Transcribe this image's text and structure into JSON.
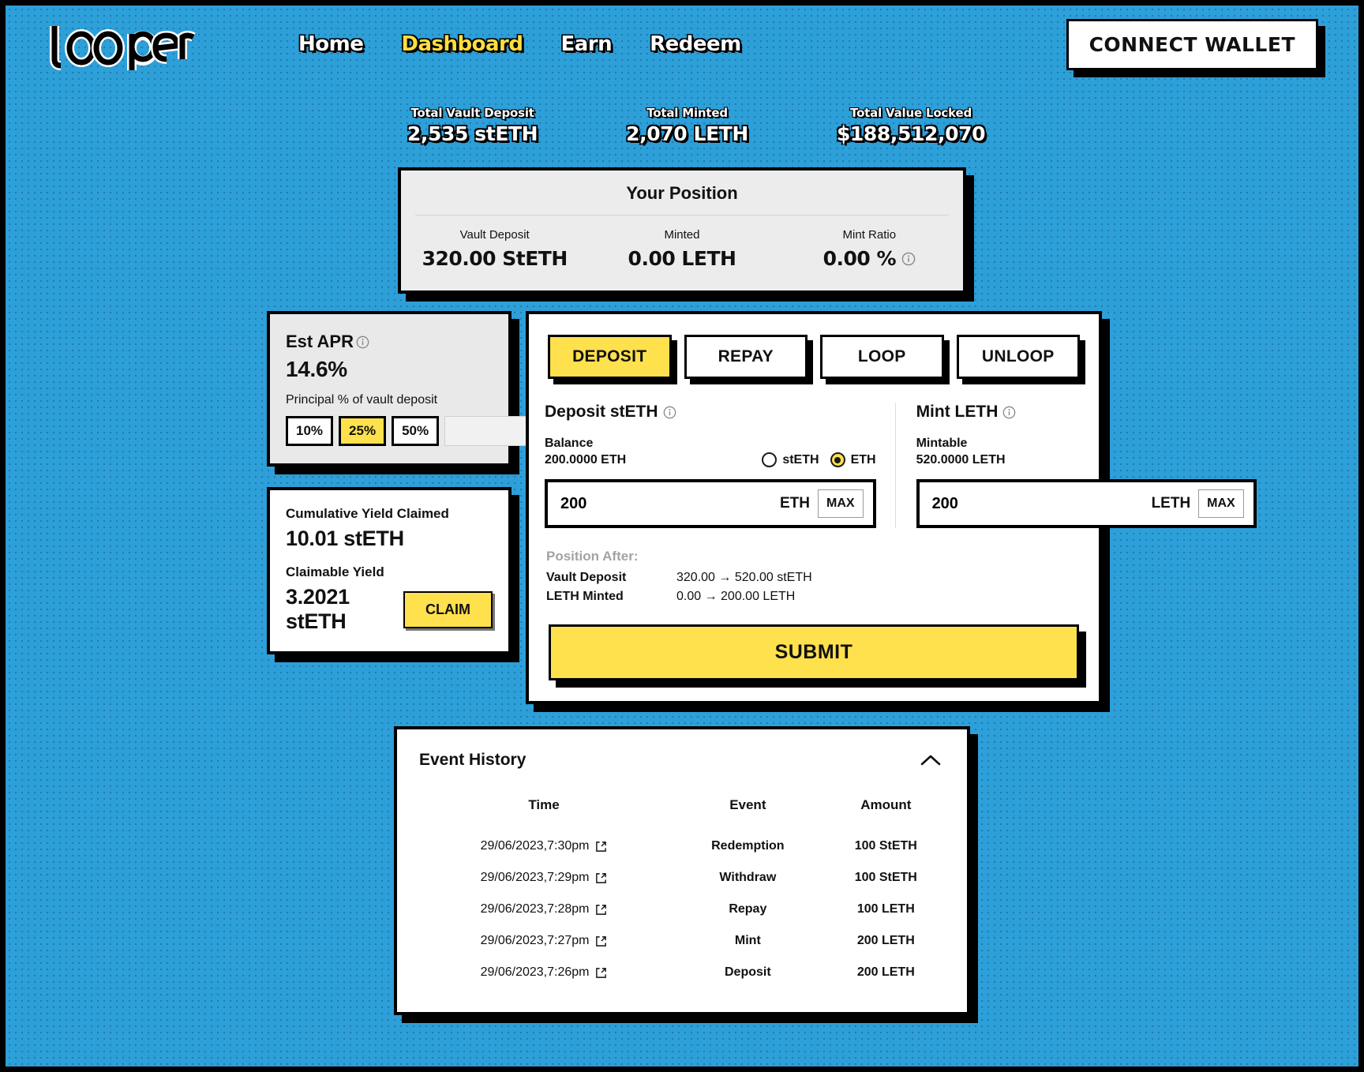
{
  "brand": {
    "logo_text": "looper"
  },
  "nav": {
    "items": [
      {
        "label": "Home",
        "active": false
      },
      {
        "label": "Dashboard",
        "active": true
      },
      {
        "label": "Earn",
        "active": false
      },
      {
        "label": "Redeem",
        "active": false
      }
    ],
    "connect_wallet_label": "CONNECT  WALLET"
  },
  "stats": [
    {
      "label": "Total Vault Deposit",
      "value": "2,535 stETH"
    },
    {
      "label": "Total Minted",
      "value": "2,070 LETH"
    },
    {
      "label": "Total Value Locked",
      "value": "$188,512,070"
    }
  ],
  "position": {
    "title": "Your Position",
    "columns": [
      {
        "label": "Vault Deposit",
        "value": "320.00 StETH",
        "info": false
      },
      {
        "label": "Minted",
        "value": "0.00 LETH",
        "info": false
      },
      {
        "label": "Mint Ratio",
        "value": "0.00 %",
        "info": true
      }
    ]
  },
  "apr": {
    "title": "Est APR",
    "value": "14.6%",
    "subtitle": "Principal % of vault deposit",
    "options": [
      {
        "label": "10%",
        "selected": false
      },
      {
        "label": "25%",
        "selected": true
      },
      {
        "label": "50%",
        "selected": false
      }
    ],
    "custom_placeholder": "%",
    "custom_value": ""
  },
  "yield": {
    "cumulative_label": "Cumulative Yield Claimed",
    "cumulative_value": "10.01 stETH",
    "claimable_label": "Claimable Yield",
    "claimable_value": "3.2021 stETH",
    "claim_label": "CLAIM"
  },
  "action": {
    "tabs": [
      {
        "label": "DEPOSIT",
        "active": true
      },
      {
        "label": "REPAY",
        "active": false
      },
      {
        "label": "LOOP",
        "active": false
      },
      {
        "label": "UNLOOP",
        "active": false
      }
    ],
    "deposit": {
      "title": "Deposit stETH",
      "balance_label": "Balance",
      "balance_value": "200.0000 ETH",
      "radios": [
        {
          "label": "stETH",
          "checked": false
        },
        {
          "label": "ETH",
          "checked": true
        }
      ],
      "input_value": "200",
      "input_unit": "ETH",
      "max_label": "MAX"
    },
    "mint": {
      "title": "Mint LETH",
      "balance_label": "Mintable",
      "balance_value": "520.0000 LETH",
      "input_value": "200",
      "input_unit": "LETH",
      "max_label": "MAX"
    },
    "position_after": {
      "title": "Position After:",
      "rows": [
        {
          "label": "Vault Deposit",
          "value": "320.00 → 520.00 stETH"
        },
        {
          "label": "LETH Minted",
          "value": "0.00 → 200.00 LETH"
        }
      ]
    },
    "submit_label": "SUBMIT"
  },
  "history": {
    "title": "Event History",
    "columns": [
      "Time",
      "Event",
      "Amount"
    ],
    "rows": [
      {
        "time": "29/06/2023,7:30pm",
        "event": "Redemption",
        "amount": "100 StETH"
      },
      {
        "time": "29/06/2023,7:29pm",
        "event": "Withdraw",
        "amount": "100 StETH"
      },
      {
        "time": "29/06/2023,7:28pm",
        "event": "Repay",
        "amount": "100 LETH"
      },
      {
        "time": "29/06/2023,7:27pm",
        "event": "Mint",
        "amount": "200 LETH"
      },
      {
        "time": "29/06/2023,7:26pm",
        "event": "Deposit",
        "amount": "200 LETH"
      }
    ]
  },
  "colors": {
    "background": "#2d9fd9",
    "accent_yellow": "#ffe14d",
    "nav_active": "#ffdf3d",
    "ink": "#000000",
    "card": "#ffffff",
    "card_gray": "#ececec"
  }
}
